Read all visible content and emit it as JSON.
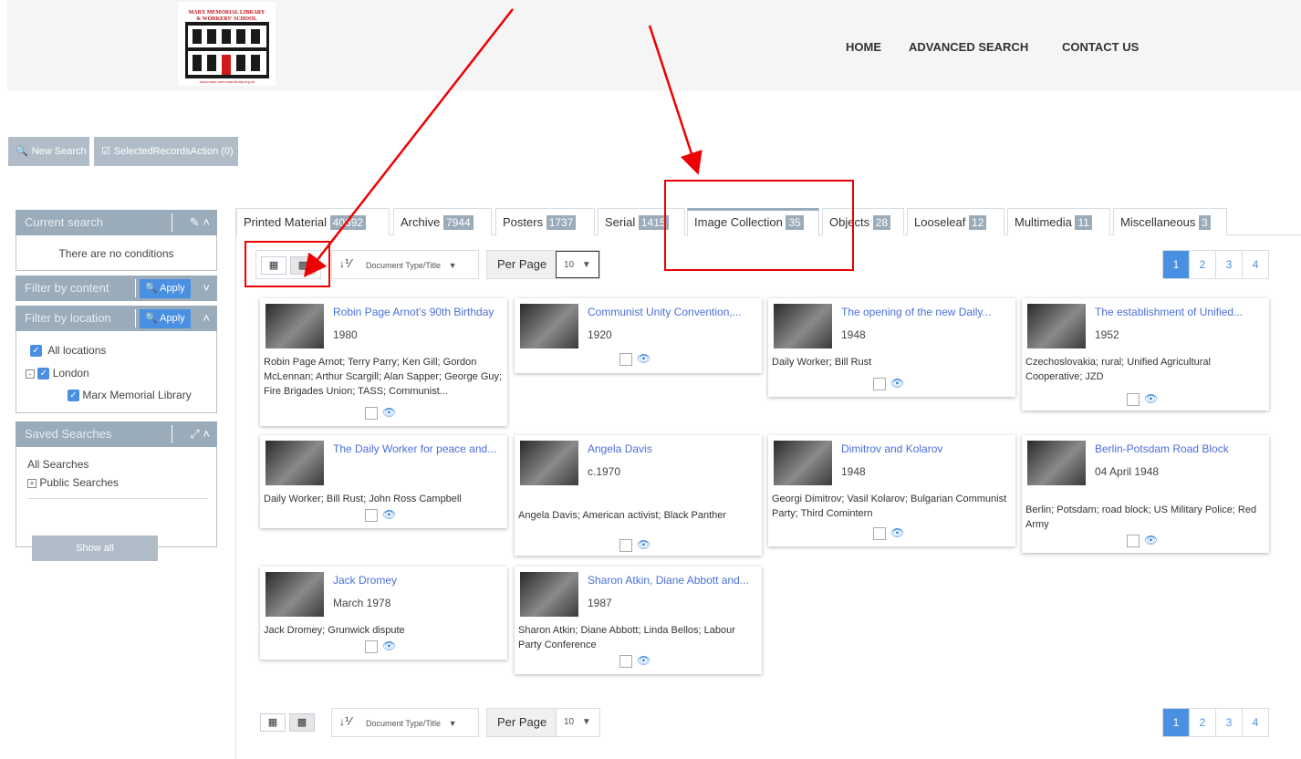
{
  "header": {
    "logo_line1": "MARX MEMORIAL LIBRARY",
    "logo_line2": "& WORKERS' SCHOOL",
    "logo_url": "www.marx-memorial-library.org.uk",
    "nav": [
      "HOME",
      "ADVANCED SEARCH",
      "CONTACT US"
    ]
  },
  "actions": {
    "new_search": "New Search",
    "selected_records": "SelectedRecordsAction (0)"
  },
  "sidebar": {
    "current_search": {
      "title": "Current search",
      "text": "There are no conditions"
    },
    "filter_content": {
      "title": "Filter by content",
      "apply": "Apply"
    },
    "filter_location": {
      "title": "Filter by location",
      "apply": "Apply",
      "items": [
        "All locations",
        "London",
        "Marx Memorial Library"
      ]
    },
    "saved_searches": {
      "title": "Saved Searches",
      "all": "All Searches",
      "public": "Public Searches",
      "show_all": "Show all"
    }
  },
  "tabs": [
    {
      "label": "Printed Material",
      "count": "40692"
    },
    {
      "label": "Archive",
      "count": "7944"
    },
    {
      "label": "Posters",
      "count": "1737"
    },
    {
      "label": "Serial",
      "count": "1415"
    },
    {
      "label": "Image Collection",
      "count": "35"
    },
    {
      "label": "Objects",
      "count": "28"
    },
    {
      "label": "Looseleaf",
      "count": "12"
    },
    {
      "label": "Multimedia",
      "count": "11"
    },
    {
      "label": "Miscellaneous",
      "count": "3"
    }
  ],
  "toolbar": {
    "sort_label": "Document Type/Title",
    "per_page_label": "Per Page",
    "per_page_value": "10",
    "pages": [
      "1",
      "2",
      "3",
      "4"
    ],
    "active_page": "1"
  },
  "cards": [
    {
      "title": "Robin Page Arnot's 90th Birthday",
      "date": "1980",
      "desc": "Robin Page Arnot; Terry Parry; Ken Gill; Gordon McLennan; Arthur Scargill; Alan Sapper; George Guy; Fire Brigades Union; TASS; Communist..."
    },
    {
      "title": "Communist Unity Convention,...",
      "date": "1920",
      "desc": ""
    },
    {
      "title": "The opening of the new Daily...",
      "date": "1948",
      "desc": "Daily Worker; Bill Rust"
    },
    {
      "title": "The establishment of Unified...",
      "date": "1952",
      "desc": "Czechoslovakia; rural; Unified Agricultural Cooperative; JZD"
    },
    {
      "title": "The Daily Worker for peace and...",
      "date": "",
      "desc": "Daily Worker; Bill Rust; John Ross Campbell"
    },
    {
      "title": "Angela Davis",
      "date": "c.1970",
      "desc": "Angela Davis; American activist; Black Panther"
    },
    {
      "title": "Dimitrov and Kolarov",
      "date": "1948",
      "desc": "Georgi Dimitrov; Vasil Kolarov; Bulgarian Communist Party; Third Comintern"
    },
    {
      "title": "Berlin-Potsdam Road Block",
      "date": "04 April 1948",
      "desc": "Berlin; Potsdam; road block; US Military Police; Red Army"
    },
    {
      "title": "Jack Dromey",
      "date": "March 1978",
      "desc": "Jack Dromey; Grunwick dispute"
    },
    {
      "title": "Sharon Atkin, Diane Abbott and...",
      "date": "1987",
      "desc": "Sharon Atkin; Diane Abbott; Linda Bellos; Labour Party Conference"
    }
  ],
  "colors": {
    "accent": "#4a90e2",
    "panel_header": "#9aabb9",
    "annotation": "#ee0000"
  }
}
